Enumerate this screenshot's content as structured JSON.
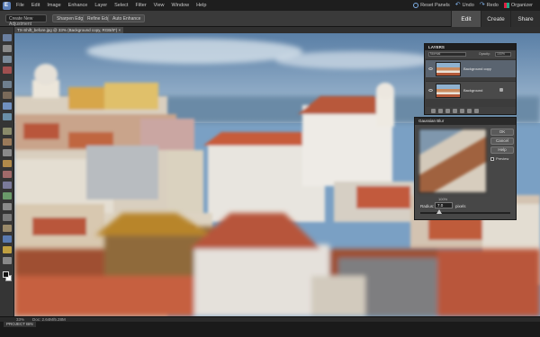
{
  "menubar": {
    "items": [
      "File",
      "Edit",
      "Image",
      "Enhance",
      "Layer",
      "Select",
      "Filter",
      "View",
      "Window",
      "Help"
    ],
    "right": [
      {
        "label": "Reset Panels",
        "icon": "reset-panels-icon"
      },
      {
        "label": "Undo",
        "icon": "undo-icon"
      },
      {
        "label": "Redo",
        "icon": "redo-icon"
      },
      {
        "label": "Organizer",
        "icon": "organizer-icon"
      }
    ]
  },
  "optbar": {
    "field1": "Create New Adjustment",
    "btn1": "Sharpen Edges",
    "btn2": "Refine Edge",
    "btn3": "Auto Enhance"
  },
  "mode_tabs": [
    "Edit",
    "Create",
    "Share"
  ],
  "active_mode": "Edit",
  "document": {
    "tab_label": "TX-Shift_before.jpg @ 33% (Background copy, RGB/8*) ×"
  },
  "status": {
    "zoom": "33%",
    "info": "Doc: 2.64M/5.28M"
  },
  "project_bin": {
    "label": "PROJECT BIN"
  },
  "layers_panel": {
    "title": "LAYERS",
    "blend_mode": "Normal",
    "opacity_label": "Opacity:",
    "opacity_value": "100%",
    "layers": [
      {
        "name": "Background copy",
        "selected": true
      },
      {
        "name": "Background",
        "selected": false
      }
    ]
  },
  "blur_dialog": {
    "title": "Gaussian Blur",
    "ok": "OK",
    "cancel": "Cancel",
    "help": "Help",
    "preview_label": "Preview",
    "zoom_value": "100%",
    "radius_label": "Radius:",
    "radius_value": "7.0",
    "radius_unit": "pixels"
  },
  "colors": {
    "accent": "#7fb0e8",
    "canvas_sky": "#7aa0c4",
    "roof_red": "#b9573a"
  }
}
